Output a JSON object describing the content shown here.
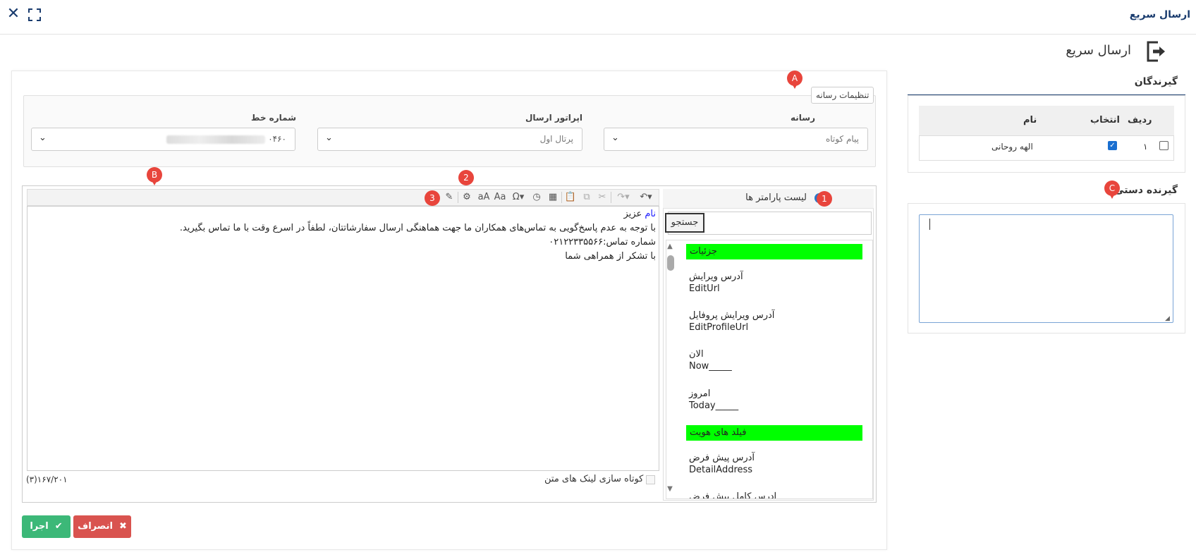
{
  "window": {
    "title": "ارسال سریع"
  },
  "header": {
    "title": "ارسال سریع"
  },
  "media_settings": {
    "legend": "تنظیمات رسانه",
    "media": {
      "label": "رسانه",
      "value": "پیام کوتاه"
    },
    "operator": {
      "label": "اپراتور ارسال",
      "value": "پرتال اول"
    },
    "line_number": {
      "label": "شماره خط",
      "value_suffix": "۰۴۶۰"
    }
  },
  "params": {
    "title": "لیست پارامتر ها",
    "search_label": "جستجو",
    "groups": [
      {
        "label": "جزئیات"
      },
      {
        "label": "فیلد های هویت"
      }
    ],
    "items": [
      {
        "fa": "آدرس ویرایش",
        "en": "EditUrl"
      },
      {
        "fa": "آدرس ویرایش پروفایل",
        "en": "EditProfileUrl"
      },
      {
        "fa": "الان",
        "en": "Now_____"
      },
      {
        "fa": "امروز",
        "en": "Today_____"
      },
      {
        "fa": "آدرس پیش فرض",
        "en": "DetailAddress"
      },
      {
        "fa": "آدرس کامل پیش فرض",
        "en": ""
      }
    ]
  },
  "editor": {
    "line1_highlight": "نام",
    "line1_rest": " عزیز",
    "line2": "با توجه به عدم پاسخ‌گویی به تماس‌های همکاران ما جهت هماهنگی ارسال سفارشاتتان، لطفاً در اسرع وقت با ما تماس بگیرید.",
    "line3": "شماره تماس:۰۲۱۲۲۳۳۵۵۶۶",
    "line4": "با تشکر از همراهی شما",
    "shorten_links_label": "کوتاه سازی لینک های متن",
    "counter": "(۳)۱۶۷/۲۰۱"
  },
  "actions": {
    "run": "اجرا",
    "cancel": "انصراف"
  },
  "recipients": {
    "title": "گیرندگان",
    "columns": {
      "row": "ردیف",
      "select": "انتخاب",
      "name": "نام"
    },
    "rows": [
      {
        "row": "۱",
        "name": "الهه روحانی",
        "selected": true
      }
    ]
  },
  "manual": {
    "title": "گیرنده دستی",
    "value": ""
  },
  "markers": {
    "a": "A",
    "b": "B",
    "c": "C",
    "one": "1",
    "two": "2",
    "three": "3"
  },
  "colors": {
    "accent": "#1a3c6e",
    "group": "#00ff00",
    "run": "#3cb878",
    "cancel": "#d9534f",
    "marker": "#e8453c"
  }
}
